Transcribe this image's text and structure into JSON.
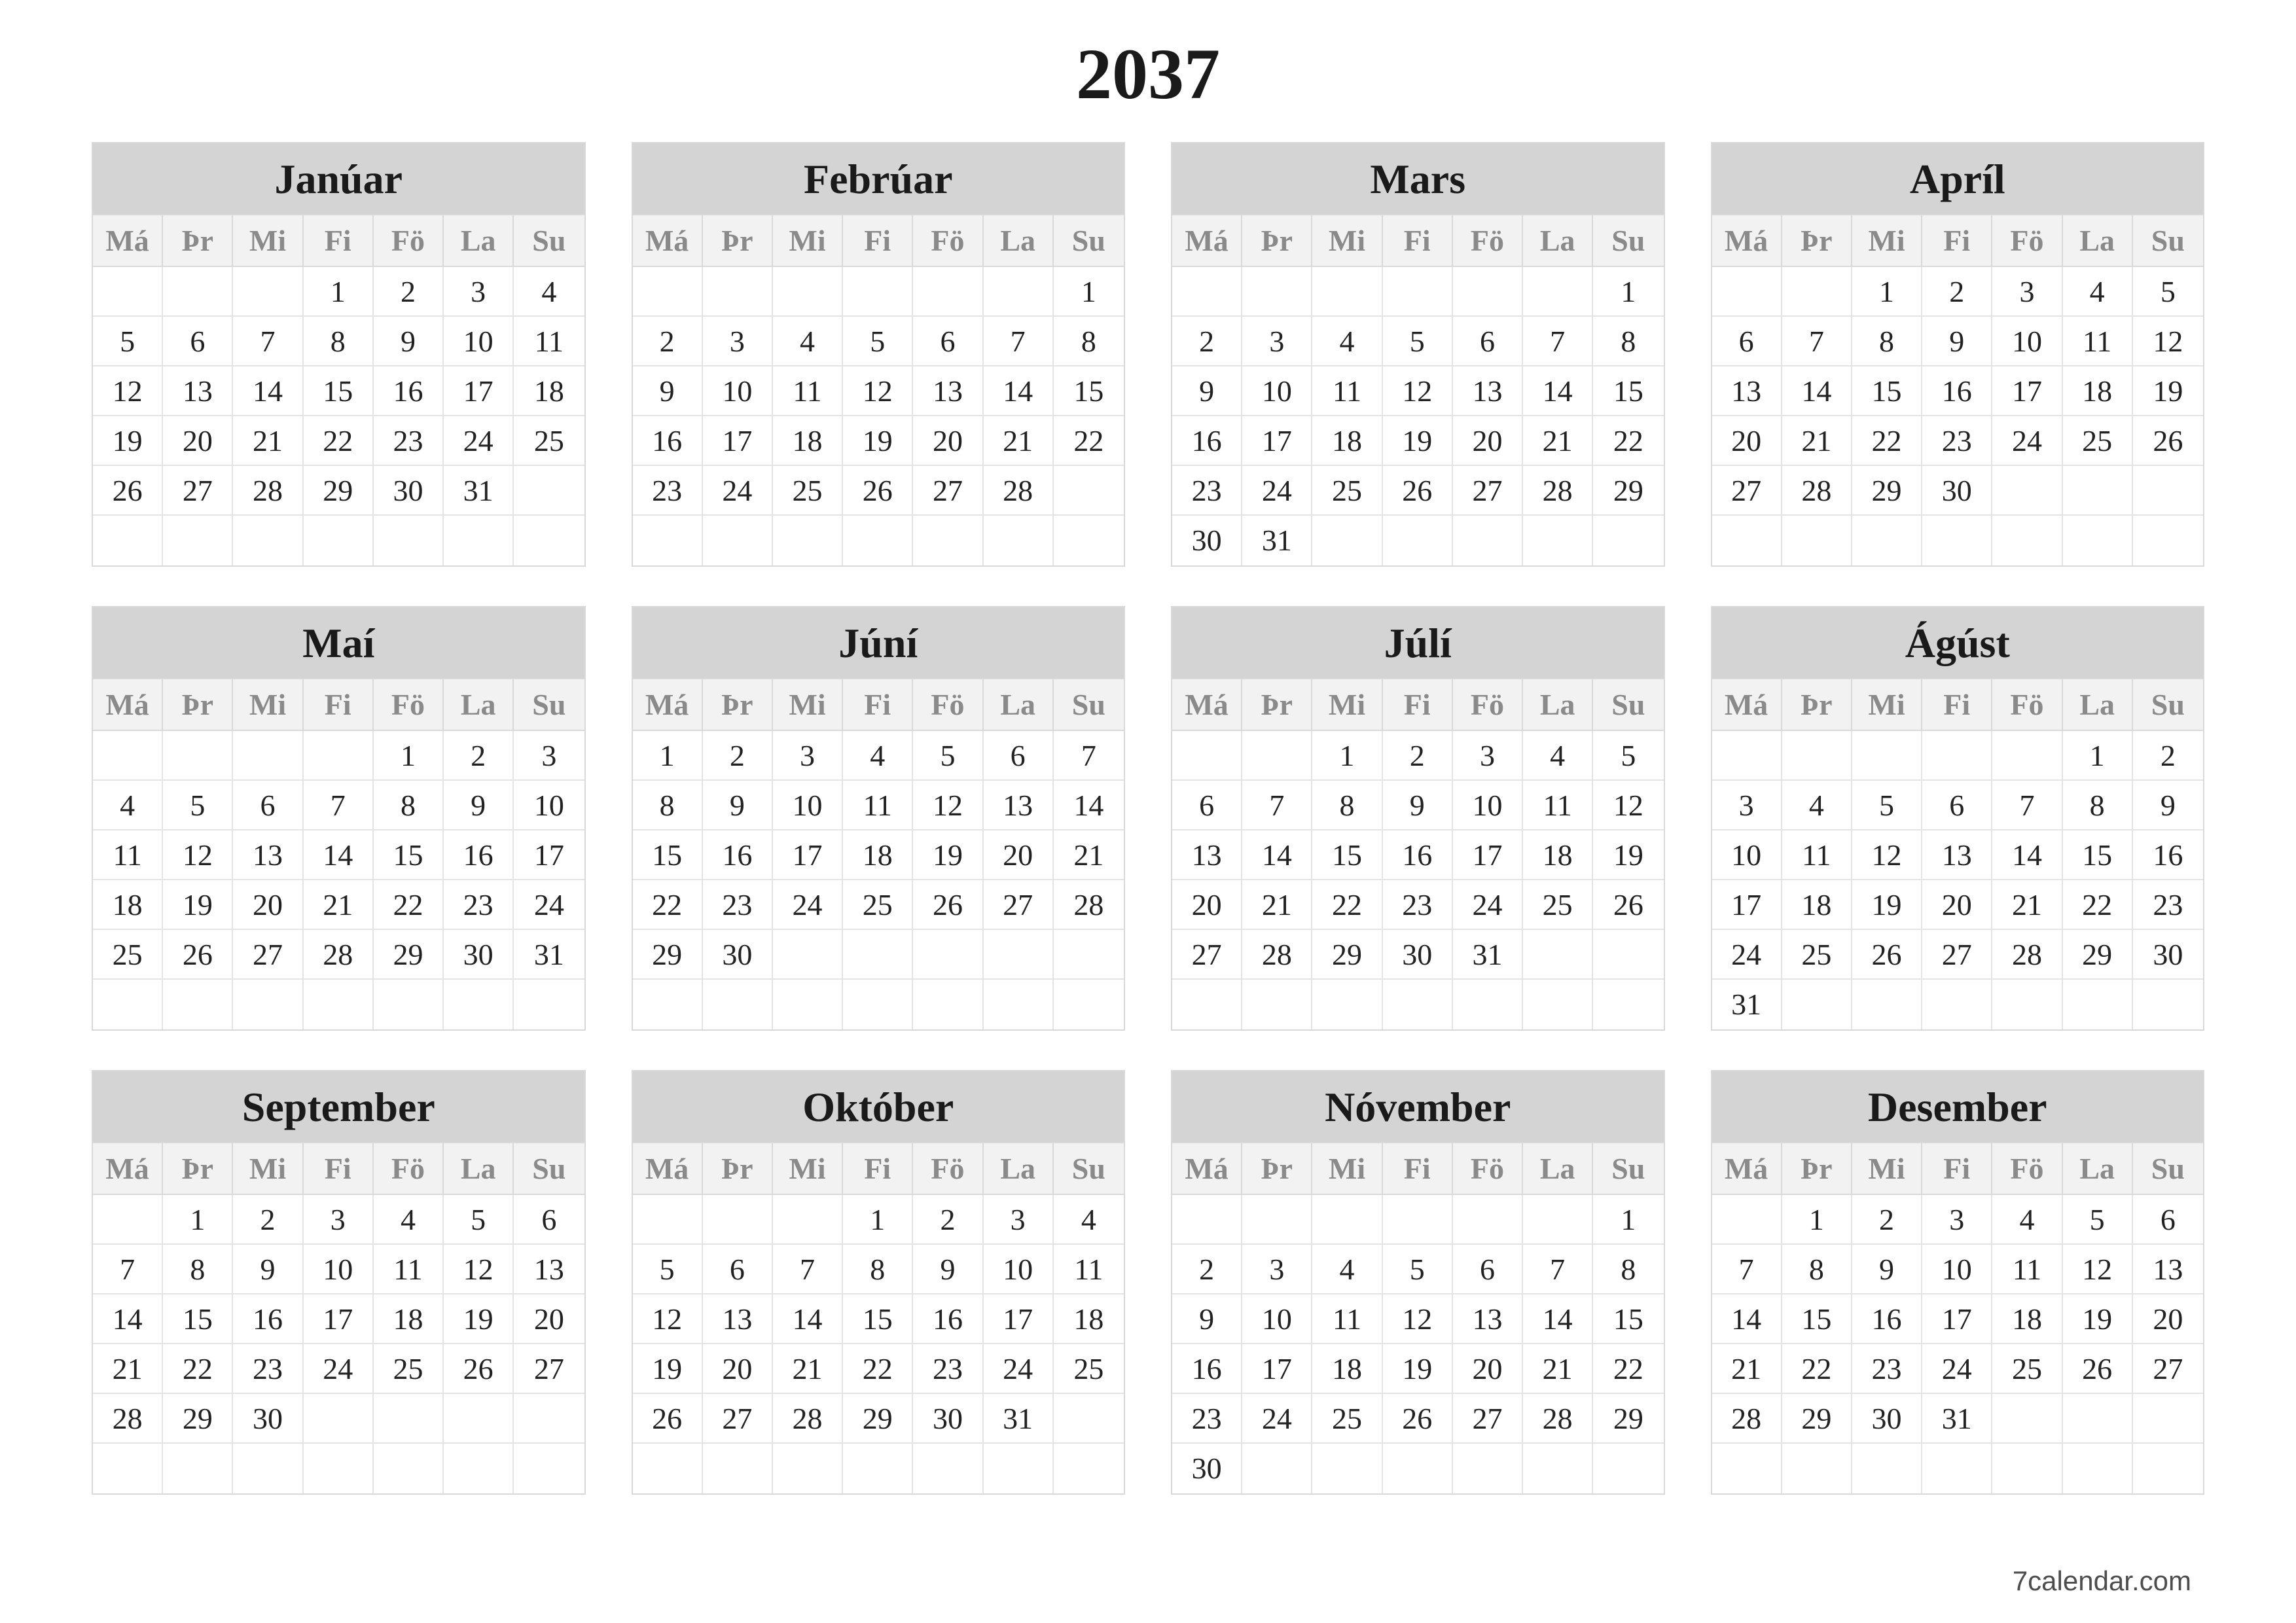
{
  "year": "2037",
  "weekdays": [
    "Má",
    "Þr",
    "Mi",
    "Fi",
    "Fö",
    "La",
    "Su"
  ],
  "footer": "7calendar.com",
  "months": [
    {
      "name": "Janúar",
      "start": 4,
      "days": 31
    },
    {
      "name": "Febrúar",
      "start": 7,
      "days": 28
    },
    {
      "name": "Mars",
      "start": 7,
      "days": 31
    },
    {
      "name": "Apríl",
      "start": 3,
      "days": 30
    },
    {
      "name": "Maí",
      "start": 5,
      "days": 31
    },
    {
      "name": "Júní",
      "start": 1,
      "days": 30
    },
    {
      "name": "Júlí",
      "start": 3,
      "days": 31
    },
    {
      "name": "Ágúst",
      "start": 6,
      "days": 31
    },
    {
      "name": "September",
      "start": 2,
      "days": 30
    },
    {
      "name": "Október",
      "start": 4,
      "days": 31
    },
    {
      "name": "Nóvember",
      "start": 7,
      "days": 30
    },
    {
      "name": "Desember",
      "start": 2,
      "days": 31
    }
  ]
}
